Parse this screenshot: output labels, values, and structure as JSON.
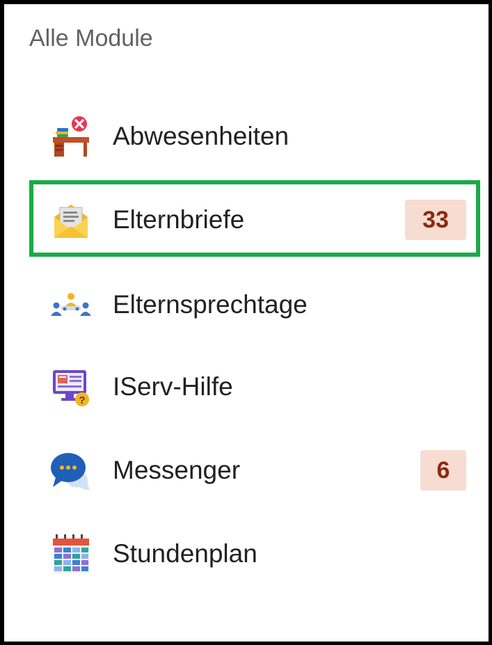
{
  "heading": "Alle Module",
  "items": [
    {
      "label": "Abwesenheiten",
      "icon": "desk-absence-icon"
    },
    {
      "label": "Elternbriefe",
      "icon": "envelope-letter-icon",
      "badge": "33"
    },
    {
      "label": "Elternsprechtage",
      "icon": "meeting-people-icon"
    },
    {
      "label": "IServ-Hilfe",
      "icon": "help-monitor-icon"
    },
    {
      "label": "Messenger",
      "icon": "chat-bubble-icon",
      "badge": "6"
    },
    {
      "label": "Stundenplan",
      "icon": "calendar-timetable-icon"
    }
  ],
  "colors": {
    "highlight": "#1aab48",
    "badge_bg": "#f7dcd2",
    "badge_text": "#8a2a0f"
  }
}
